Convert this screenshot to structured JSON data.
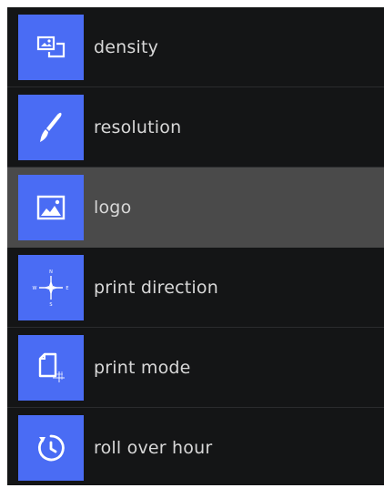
{
  "menu": {
    "items": [
      {
        "label": "density",
        "icon": "image-stack-icon",
        "selected": false
      },
      {
        "label": "resolution",
        "icon": "paintbrush-icon",
        "selected": false
      },
      {
        "label": "logo",
        "icon": "picture-icon",
        "selected": true
      },
      {
        "label": "print direction",
        "icon": "compass-icon",
        "compass_letters": {
          "n": "N",
          "w": "W",
          "e": "E",
          "s": "S"
        },
        "selected": false
      },
      {
        "label": "print mode",
        "icon": "document-icon",
        "selected": false
      },
      {
        "label": "roll over hour",
        "icon": "clock-rollover-icon",
        "selected": false
      }
    ]
  },
  "colors": {
    "tile": "#4a6cf4",
    "background": "#141516",
    "selected_row": "#4a4a4a",
    "label_text": "#d8d8d8"
  }
}
